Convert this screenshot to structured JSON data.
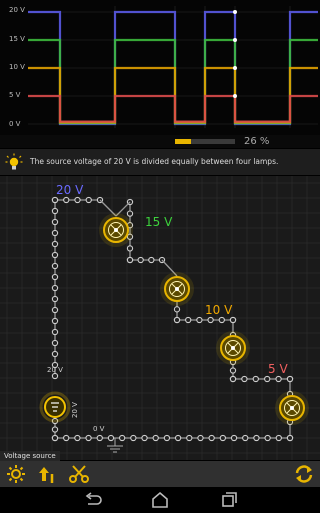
{
  "scope": {
    "y_labels": [
      "20 V",
      "15 V",
      "10 V",
      "5 V",
      "0 V"
    ],
    "trace_colors": [
      "#5a5ae6",
      "#3cb83c",
      "#e0a000",
      "#d94a4a"
    ]
  },
  "progress": {
    "percent": 26,
    "label": "26 %",
    "color": "#e8b500"
  },
  "info": {
    "text": "The source voltage of 20 V is divided equally between four lamps.",
    "icon": "lightbulb-icon"
  },
  "circuit": {
    "nodes": [
      {
        "label": "20 V",
        "color": "#6a6aff"
      },
      {
        "label": "15 V",
        "color": "#3cd13c"
      },
      {
        "label": "10 V",
        "color": "#f0a800"
      },
      {
        "label": "5 V",
        "color": "#f06060"
      }
    ],
    "source_top_label": "20 V",
    "source_side_label": "20 V",
    "ground_label": "0 V"
  },
  "mode_tag": "Voltage source",
  "toolbar": {
    "items": [
      "component-menu-icon",
      "upload-icon",
      "cut-wire-icon",
      "refresh-icon"
    ]
  },
  "navbar": {
    "items": [
      "back-icon",
      "home-icon",
      "recent-apps-icon"
    ]
  }
}
